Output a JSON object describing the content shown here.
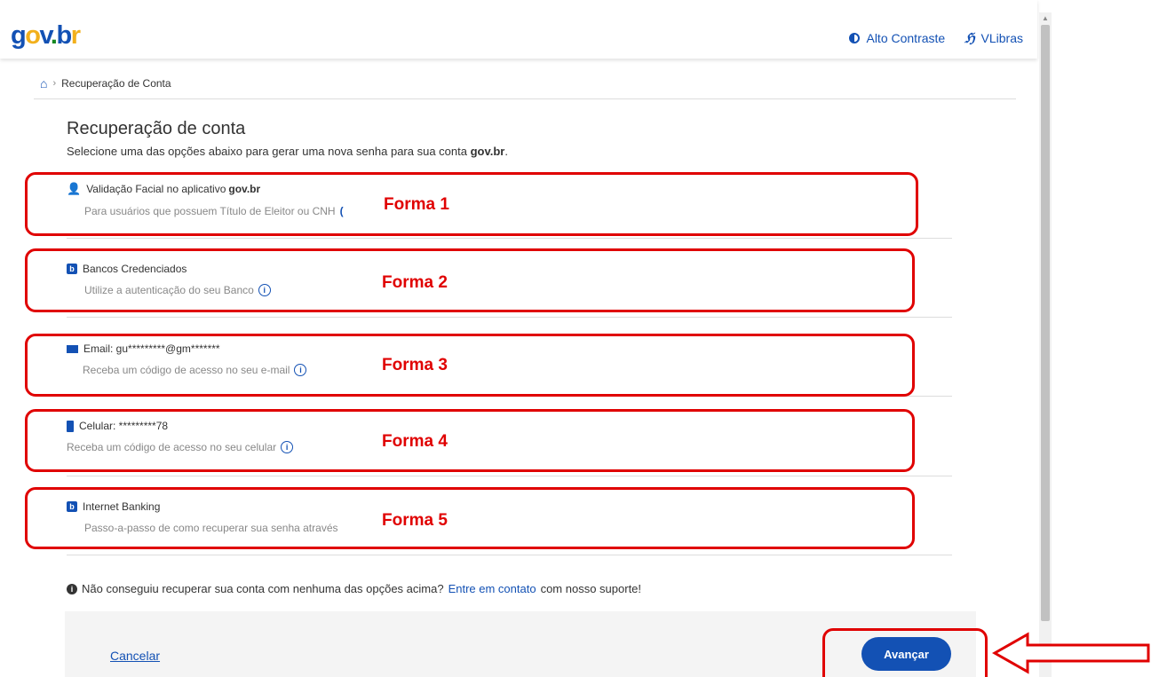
{
  "header": {
    "logo": {
      "g": "g",
      "o": "o",
      "v": "v",
      "b": "b",
      "r": "r"
    },
    "contrast_label": "Alto Contraste",
    "libras_label": "VLibras"
  },
  "breadcrumb": {
    "current": "Recuperação de Conta"
  },
  "page": {
    "title": "Recuperação de conta",
    "subtitle_prefix": "Selecione uma das opções abaixo para gerar uma nova senha para sua conta ",
    "subtitle_bold": "gov.br",
    "subtitle_suffix": "."
  },
  "options": [
    {
      "title": "Validação Facial no aplicativo ",
      "title_bold": "gov.br",
      "desc": "Para usuários que possuem Título de Eleitor ou CNH",
      "icon": "face-id-icon"
    },
    {
      "title": "Bancos Credenciados",
      "desc": "Utilize a autenticação do seu Banco",
      "icon": "bank-icon"
    },
    {
      "title": "Email: gu*********@gm*******",
      "desc": "Receba um código de acesso no seu e-mail",
      "icon": "envelope-icon"
    },
    {
      "title": "Celular: *********78",
      "desc": "Receba um código de acesso no seu celular",
      "icon": "phone-icon"
    },
    {
      "title": "Internet Banking",
      "desc": "Passo-a-passo de como recuperar sua senha através",
      "icon": "bank-icon"
    }
  ],
  "annotations": [
    "Forma 1",
    "Forma 2",
    "Forma 3",
    "Forma 4",
    "Forma 5"
  ],
  "annotation_color": "#e00000",
  "note": {
    "prefix": "Não conseguiu recuperar sua conta com nenhuma das opções acima? ",
    "link": "Entre em contato",
    "suffix": " com nosso suporte!"
  },
  "footer": {
    "cancel": "Cancelar",
    "advance": "Avançar"
  },
  "colors": {
    "primary": "#1351B4",
    "highlight": "#e00000"
  }
}
